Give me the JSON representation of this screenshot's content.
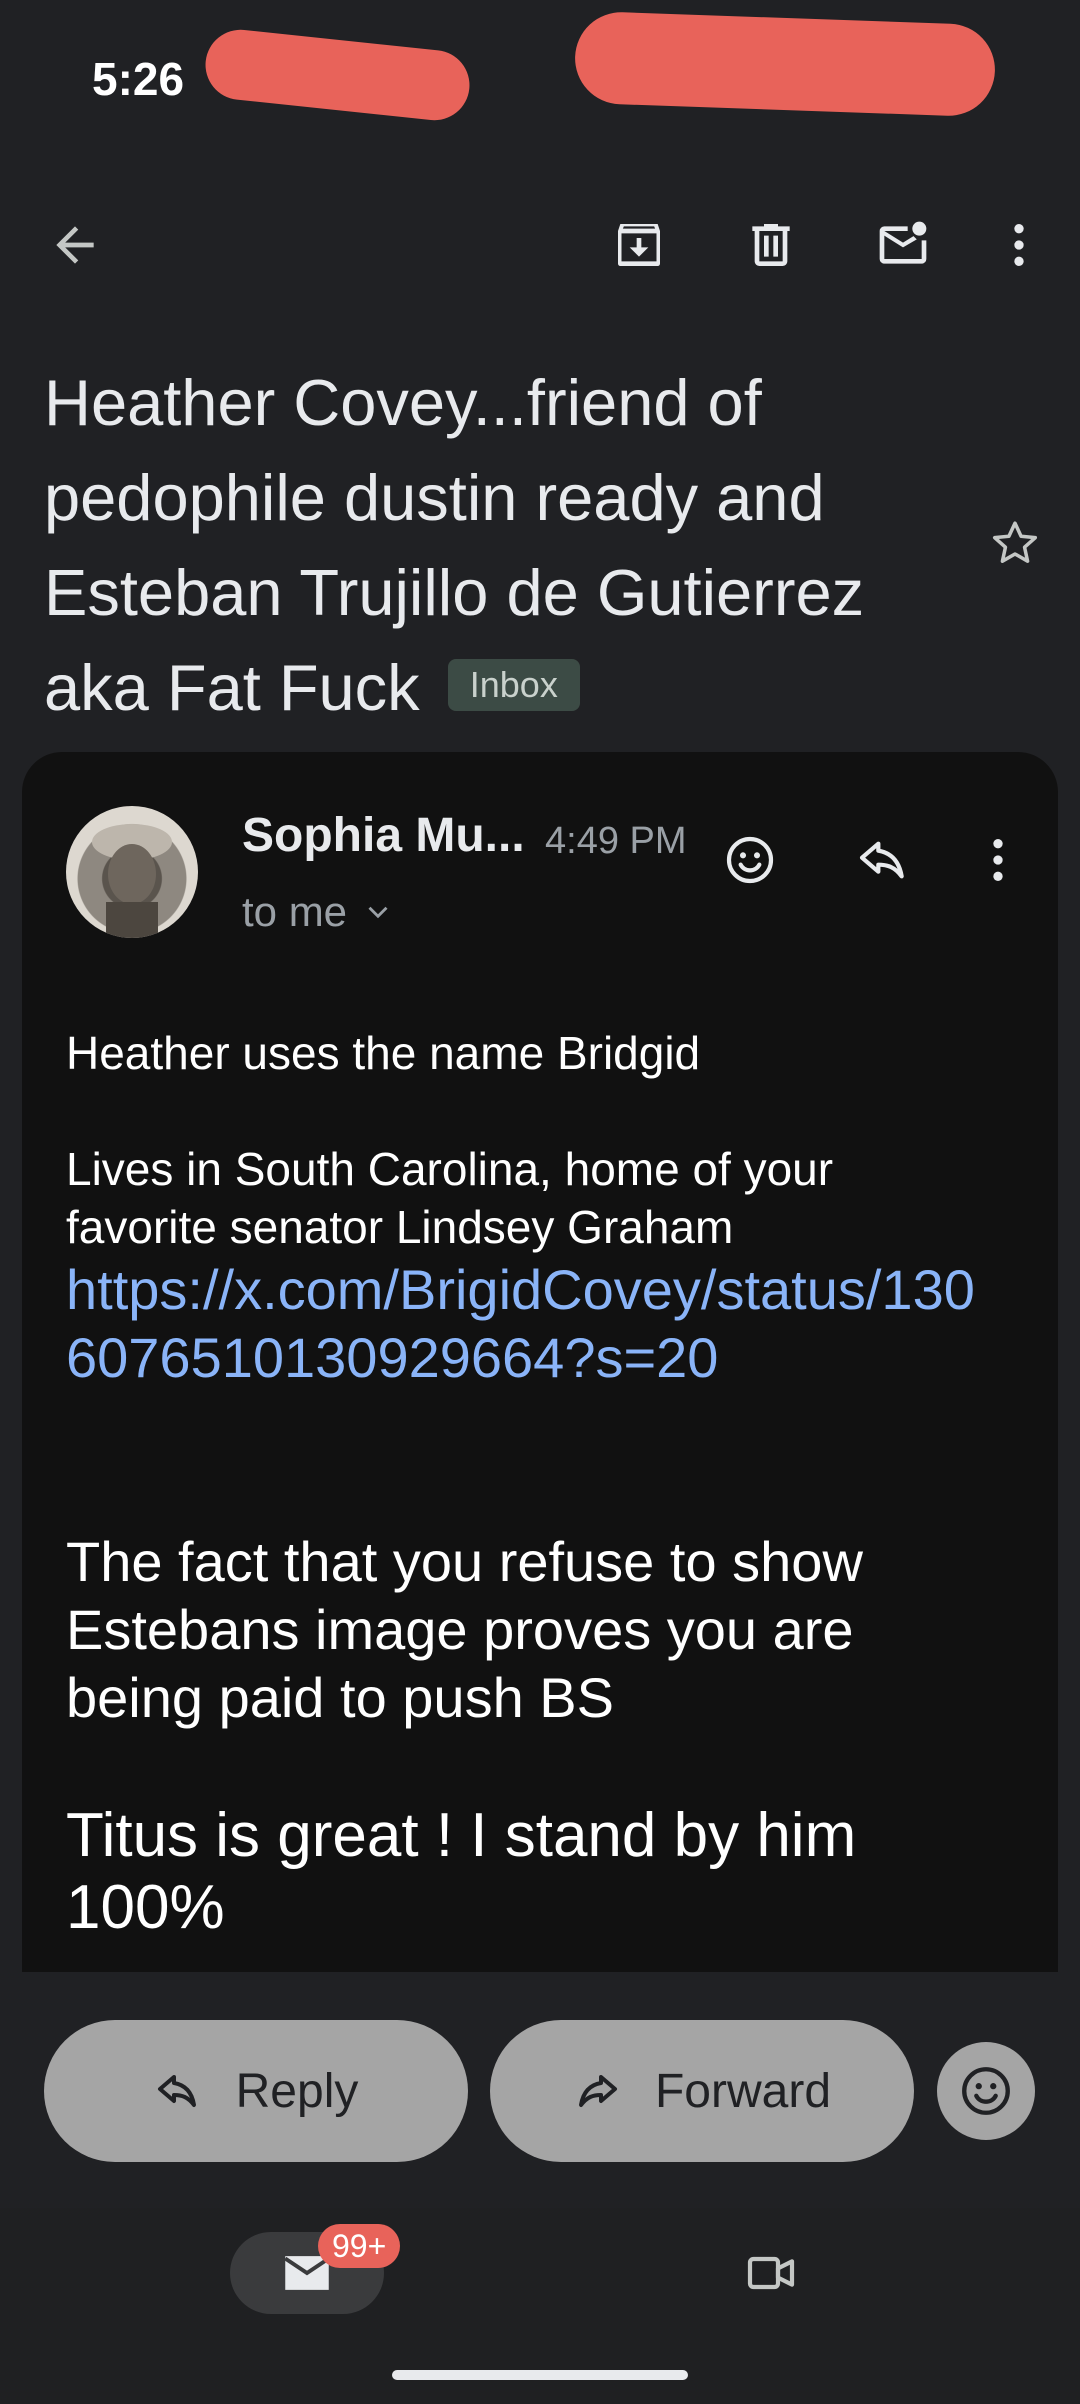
{
  "status_bar": {
    "time": "5:26"
  },
  "toolbar": {
    "back": "back-arrow-icon",
    "archive": "archive-icon",
    "delete": "delete-icon",
    "mark_unread": "mark-unread-icon",
    "more": "more-vert-icon"
  },
  "email": {
    "subject": "Heather Covey...friend of pedophile dustin ready and Esteban Trujillo de Gutierrez aka Fat Fuck",
    "label": "Inbox",
    "sender": "Sophia Mu...",
    "time": "4:49 PM",
    "recipient": "to me",
    "body": {
      "line1": "Heather uses the name Bridgid",
      "line2": "Lives in South Carolina, home of your favorite senator Lindsey Graham",
      "link": "https://x.com/BrigidCovey/status/1306076510130929664?s=20",
      "para3": "The fact that you refuse to show Estebans image proves you are being paid to push BS",
      "para4": "Titus is great ! I stand by him 100%"
    }
  },
  "actions": {
    "reply_label": "Reply",
    "forward_label": "Forward"
  },
  "nav": {
    "mail_badge": "99+"
  },
  "colors": {
    "background": "#202124",
    "card": "#111111",
    "link": "#8ab4f8",
    "pill": "#a5a5a5",
    "badge": "#e8635a"
  }
}
